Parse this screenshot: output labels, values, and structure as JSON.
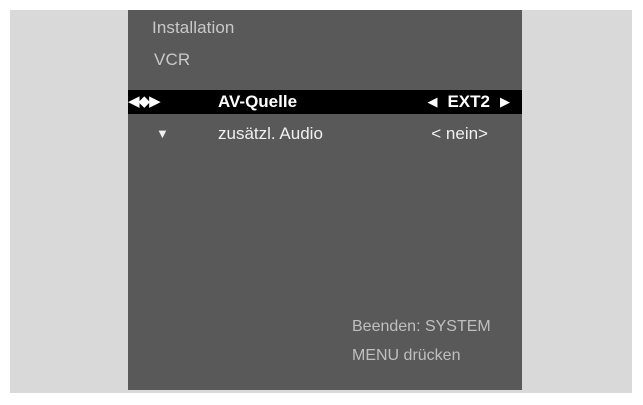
{
  "menu": {
    "title": "Installation",
    "subtitle": "VCR",
    "items": [
      {
        "nav_icon": "◀◆▶",
        "label": "AV-Quelle",
        "value": "EXT2",
        "left_arrow": "◀",
        "right_arrow": "▶"
      },
      {
        "nav_icon": "▼",
        "label": "zusätzl. Audio",
        "value": "< nein>"
      }
    ],
    "hint_line1": "Beenden: SYSTEM",
    "hint_line2": "MENU drücken"
  },
  "colors": {
    "outer_frame": "#d9d9d9",
    "osd_background": "#595959",
    "selected_row": "#000000",
    "text": "#ffffff"
  },
  "icons": {
    "nav": "left-diamond-right-nav-icon",
    "down": "down-arrow-icon",
    "value_left": "left-arrow-icon",
    "value_right": "right-arrow-icon"
  }
}
